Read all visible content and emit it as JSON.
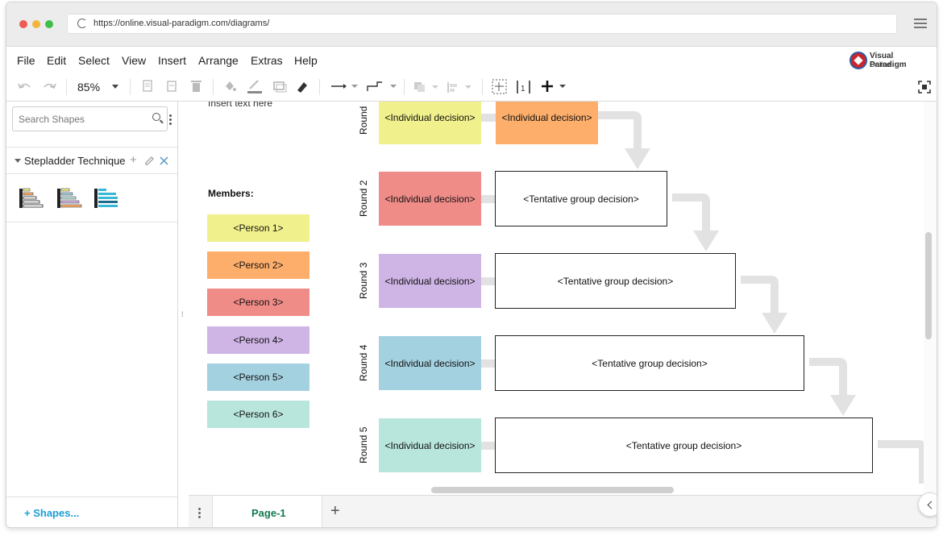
{
  "browser": {
    "url": "https://online.visual-paradigm.com/diagrams/",
    "dots": [
      "#ee5b53",
      "#f5b53b",
      "#3fbf4a"
    ]
  },
  "menu": {
    "items": [
      "File",
      "Edit",
      "Select",
      "View",
      "Insert",
      "Arrange",
      "Extras",
      "Help"
    ],
    "logo_line1": "Visual Paradigm",
    "logo_line2": "Online"
  },
  "toolbar": {
    "zoom": "85%"
  },
  "sidebar": {
    "search_placeholder": "Search Shapes",
    "library_name": "Stepladder Technique",
    "shapes_link": "Shapes..."
  },
  "diagram": {
    "insert_text": "Insert text here",
    "members_label": "Members:",
    "members": [
      {
        "label": "<Person 1>",
        "color": "#f0f08c"
      },
      {
        "label": "<Person 2>",
        "color": "#fdae6b"
      },
      {
        "label": "<Person 3>",
        "color": "#f08c88"
      },
      {
        "label": "<Person 4>",
        "color": "#cfb5e5"
      },
      {
        "label": "<Person 5>",
        "color": "#a4d1e0"
      },
      {
        "label": "<Person 6>",
        "color": "#b9e6dc"
      }
    ],
    "rounds": [
      {
        "label": "Round",
        "individual": "<Individual decision>",
        "group": "<Individual decision>",
        "color": "#f0f08c",
        "group_color": "#fdae6b"
      },
      {
        "label": "Round 2",
        "individual": "<Individual decision>",
        "group": "<Tentative group decision>",
        "color": "#f08c88"
      },
      {
        "label": "Round 3",
        "individual": "<Individual decision>",
        "group": "<Tentative group decision>",
        "color": "#cfb5e5"
      },
      {
        "label": "Round 4",
        "individual": "<Individual decision>",
        "group": "<Tentative group decision>",
        "color": "#a4d1e0"
      },
      {
        "label": "Round 5",
        "individual": "<Individual decision>",
        "group": "<Tentative group decision>",
        "color": "#b9e6dc"
      }
    ]
  },
  "footer": {
    "page_tab": "Page-1"
  }
}
